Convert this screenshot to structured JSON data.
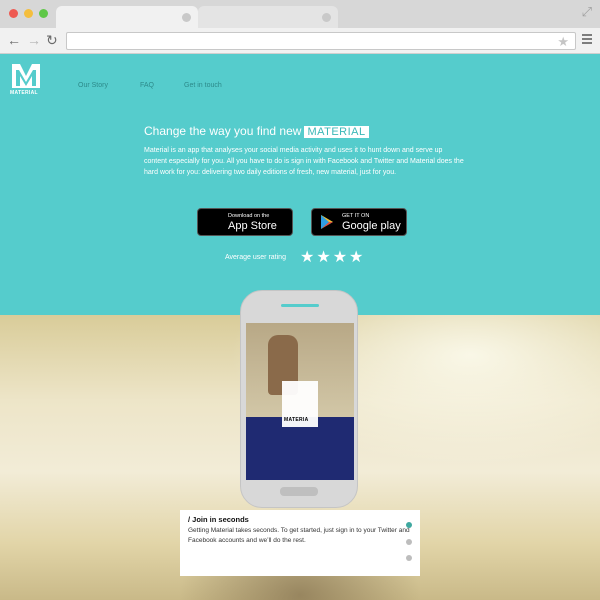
{
  "brand": {
    "logo_text": "MATERIAL",
    "accent": "#55cccc"
  },
  "nav": {
    "items": [
      "Our Story",
      "FAQ",
      "Get in touch"
    ]
  },
  "hero": {
    "headline": "Change the way you find new",
    "headline_tag": "MATERIAL",
    "description": "Material is an app that analyses your social media activity and uses it to hunt down and serve up content especially for you. All you have to do is sign in with Facebook and Twitter and Material does the hard work for you: delivering two daily editions of fresh, new material, just for you."
  },
  "stores": {
    "app_store": {
      "small": "Download on the",
      "big": "App Store",
      "icon": "apple-icon"
    },
    "google_play": {
      "small": "GET IT ON",
      "big": "Google play",
      "icon": "play-icon"
    }
  },
  "rating": {
    "label": "Average user rating",
    "stars": 4,
    "max": 4
  },
  "phone": {
    "app_label": "MATERIA"
  },
  "card": {
    "title": "/ Join in seconds",
    "text": "Getting Material takes seconds. To get started, just sign in to your Twitter and Facebook accounts and we’ll do the rest."
  },
  "pager": {
    "count": 3,
    "active": 0,
    "active_color": "#3fa8a0",
    "inactive_color": "#bdbdbd"
  }
}
